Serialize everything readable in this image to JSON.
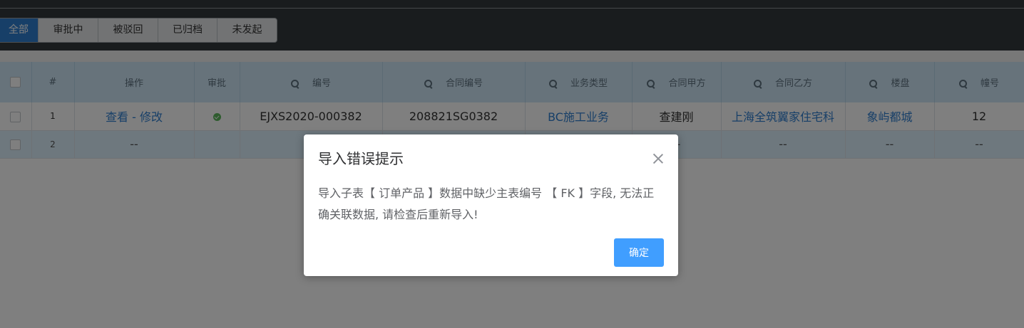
{
  "tabs": [
    {
      "label": "全部",
      "active": true
    },
    {
      "label": "审批中"
    },
    {
      "label": "被驳回"
    },
    {
      "label": "已归档"
    },
    {
      "label": "未发起"
    }
  ],
  "table": {
    "headers": {
      "num": "#",
      "action": "操作",
      "approval": "审批",
      "code": "编号",
      "contract_no": "合同编号",
      "business_type": "业务类型",
      "party_a": "合同甲方",
      "party_b": "合同乙方",
      "project": "楼盘",
      "building": "幢号"
    },
    "rows": [
      {
        "index": "1",
        "action_view": "查看",
        "action_sep": " - ",
        "action_edit": "修改",
        "approval_icon": "check-circle",
        "code": "EJXS2020-000382",
        "contract_no": "208821SG0382",
        "business_type": "BC施工业务",
        "party_a": "查建刚",
        "party_b": "上海全筑翼家住宅科",
        "project": "象屿都城",
        "building": "12"
      },
      {
        "index": "2",
        "action": "--",
        "approval": "",
        "code": "",
        "contract_no": "",
        "business_type": "",
        "party_a": "--",
        "party_b": "--",
        "project": "--",
        "building": "--"
      }
    ]
  },
  "dialog": {
    "title": "导入错误提示",
    "message": "导入子表【 订单产品 】数据中缺少主表编号 【 FK 】字段, 无法正确关联数据, 请检查后重新导入!",
    "confirm_label": "确定"
  },
  "colors": {
    "header_bg": "#33383d",
    "tab_active": "#2f7fd1",
    "table_header": "#cfe7f7",
    "link": "#2f7fd1",
    "primary_button": "#409eff",
    "approved": "#5cb85c"
  }
}
